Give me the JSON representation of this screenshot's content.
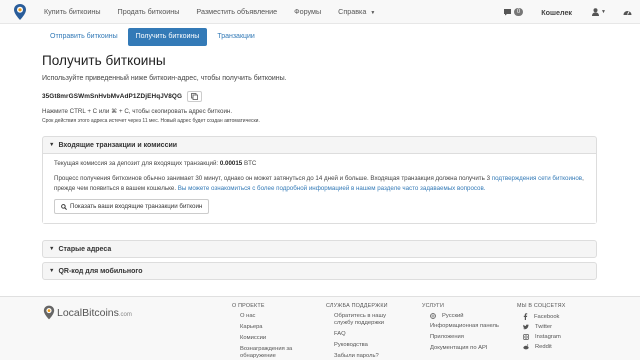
{
  "nav": {
    "links": [
      "Купить биткоины",
      "Продать биткоины",
      "Разместить объявление",
      "Форумы",
      "Справка"
    ],
    "message_count": "0",
    "wallet": "Кошелек"
  },
  "tabs": [
    "Отправить биткоины",
    "Получить биткоины",
    "Транзакции"
  ],
  "page": {
    "title": "Получить биткоины",
    "lead": "Используйте приведенный ниже биткоин-адрес, чтобы получить биткоины.",
    "address": "35Gt8mrGSWmSnHvbMvAdP1ZDjEHqJV8QG",
    "hint": "Нажмите CTRL + C или ⌘ + C, чтобы скопировать адрес биткоин.",
    "expire": "Срок действия этого адреса истечет через 11 мес. Новый адрес будет создан автоматически."
  },
  "incoming": {
    "header": "Входящие транзакции и комиссии",
    "commission_label": "Текущая комиссия за депозит для входящих транзакций:",
    "commission_value": "0.00015",
    "commission_unit": "BTC",
    "para_1": "Процесс получения биткоинов обычно занимает 30 минут, однако он может затянуться до 14 дней и больше. Входящая транзакция должна получить 3",
    "para_link_1": "подтверждения сети биткоинов",
    "para_2": ", прежде чем появиться в вашем кошельке.",
    "para_link_2": "Вы можете ознакомиться с более подробной информацией в нашем разделе часто задаваемых вопросов.",
    "button": "Показать ваши входящие транзакции биткоин"
  },
  "old_addresses": {
    "header": "Старые адреса"
  },
  "qr": {
    "header": "QR-код для мобильного"
  },
  "footer": {
    "logo_main": "LocalBitcoins",
    "logo_suffix": ".com",
    "col1": {
      "title": "О ПРОЕКТЕ",
      "items": [
        "О нас",
        "Карьера",
        "Комиссии",
        "Вознаграждения за обнаружение"
      ]
    },
    "col2": {
      "title": "СЛУЖБА ПОДДЕРЖКИ",
      "items": [
        "Обратитесь в нашу службу поддержки",
        "FAQ",
        "Руководства",
        "Забыли пароль?"
      ]
    },
    "col3": {
      "title": "УСЛУГИ",
      "items": [
        "Русский",
        "Информационная панель",
        "Приложения",
        "Документация по API"
      ]
    },
    "col4": {
      "title": "МЫ В СОЦСЕТЯХ",
      "items": [
        "Facebook",
        "Twitter",
        "Instagram",
        "Reddit"
      ]
    }
  },
  "colors": {
    "primary": "#337ab7",
    "navbar": "#f8f8f8",
    "panel": "#f5f5f5"
  }
}
